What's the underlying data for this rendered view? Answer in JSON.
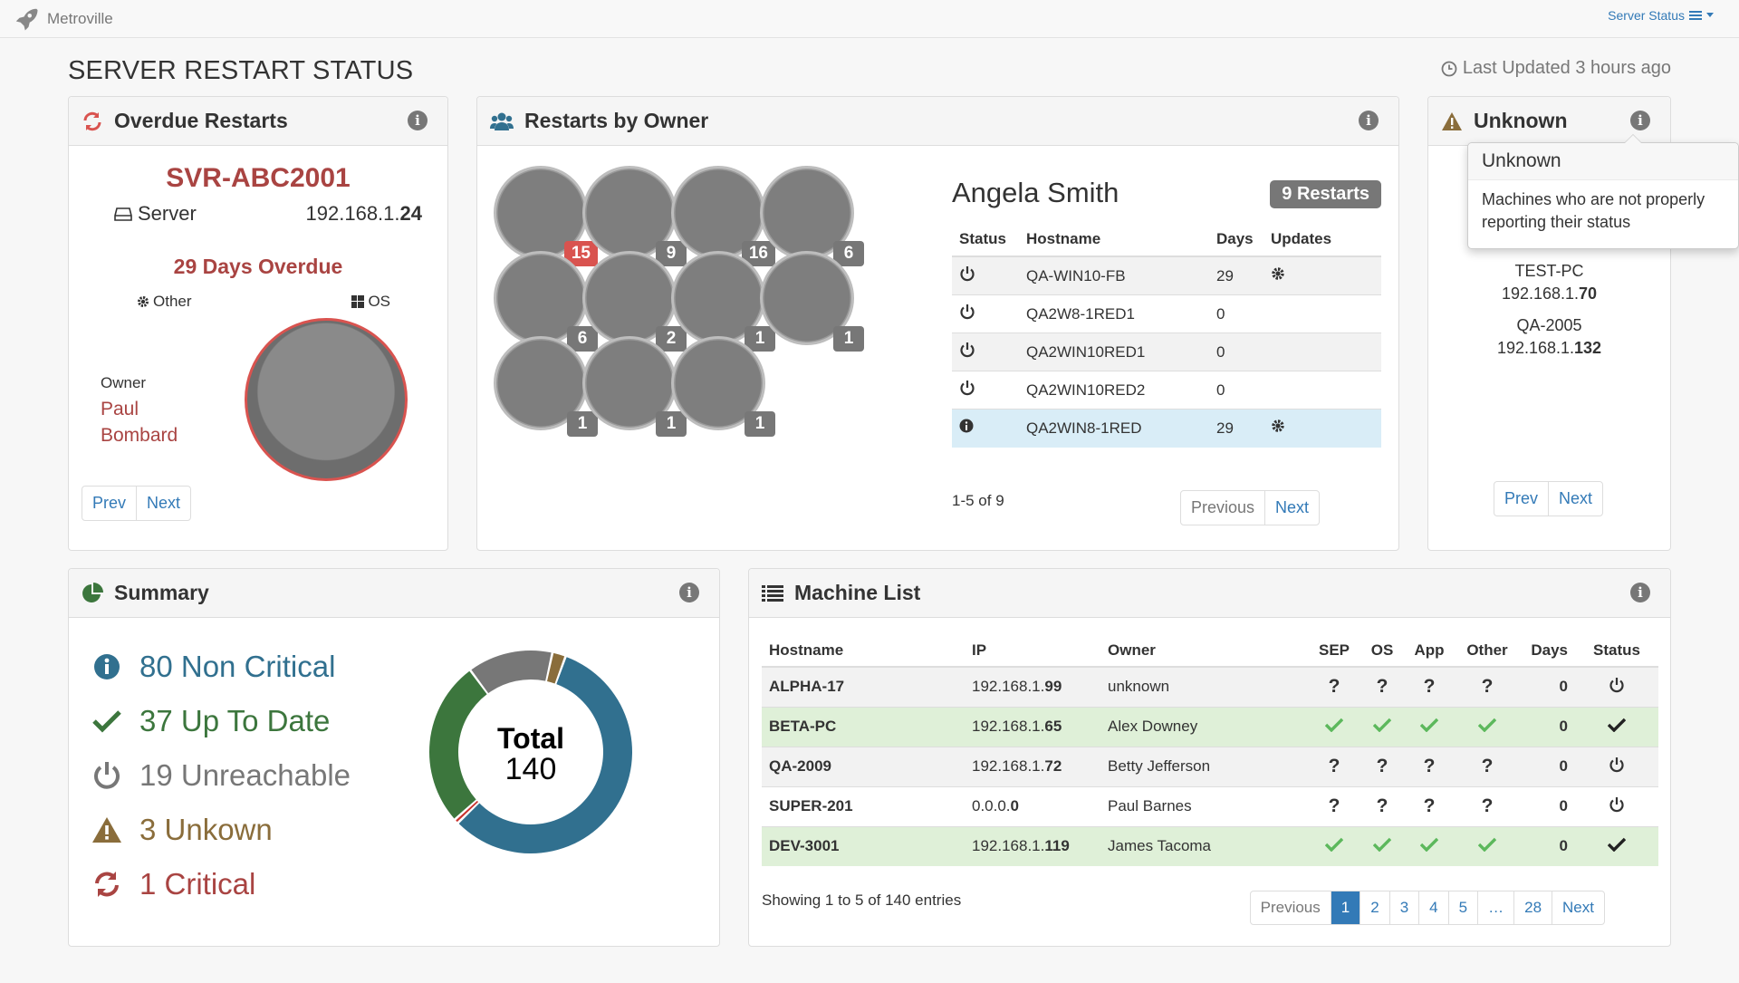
{
  "nav": {
    "brand": "Metroville",
    "menu": "Server Status"
  },
  "page": {
    "title": "SERVER RESTART STATUS",
    "last_updated": "Last Updated 3 hours ago"
  },
  "overdue": {
    "title": "Overdue Restarts",
    "hostname": "SVR-ABC2001",
    "type_label": "Server",
    "ip_prefix": "192.168.1.",
    "ip_last": "24",
    "days_overdue": "29 Days Overdue",
    "tag_other": "Other",
    "tag_os": "OS",
    "owner_label": "Owner",
    "owner_first": "Paul",
    "owner_last": "Bombard",
    "prev": "Prev",
    "next": "Next"
  },
  "owners": {
    "title": "Restarts by Owner",
    "avatars": [
      {
        "count": "15",
        "critical": true
      },
      {
        "count": "9",
        "critical": false
      },
      {
        "count": "16",
        "critical": false
      },
      {
        "count": "6",
        "critical": false
      },
      {
        "count": "6",
        "critical": false
      },
      {
        "count": "2",
        "critical": false
      },
      {
        "count": "1",
        "critical": false
      },
      {
        "count": "1",
        "critical": false
      },
      {
        "count": "1",
        "critical": false
      },
      {
        "count": "1",
        "critical": false
      },
      {
        "count": "1",
        "critical": false
      }
    ],
    "selected_owner": "Angela Smith",
    "restarts_badge": "9 Restarts",
    "columns": [
      "Status",
      "Hostname",
      "Days",
      "Updates"
    ],
    "rows": [
      {
        "status": "power",
        "hostname": "QA-WIN10-FB",
        "days": "29",
        "updates": "gear"
      },
      {
        "status": "power",
        "hostname": "QA2W8-1RED1",
        "days": "0",
        "updates": ""
      },
      {
        "status": "power",
        "hostname": "QA2WIN10RED1",
        "days": "0",
        "updates": ""
      },
      {
        "status": "power",
        "hostname": "QA2WIN10RED2",
        "days": "0",
        "updates": ""
      },
      {
        "status": "info",
        "hostname": "QA2WIN8-1RED",
        "days": "29",
        "updates": "gear"
      }
    ],
    "count": "1-5 of 9",
    "prev": "Previous",
    "next": "Next"
  },
  "unknown": {
    "title": "Unknown",
    "popover_title": "Unknown",
    "popover_body": "Machines who are not properly reporting their status",
    "items": [
      {
        "host": "TEST-PC",
        "ip_prefix": "192.168.1.",
        "ip_last": "70"
      },
      {
        "host": "QA-2005",
        "ip_prefix": "192.168.1.",
        "ip_last": "132"
      }
    ],
    "prev": "Prev",
    "next": "Next"
  },
  "summary": {
    "title": "Summary",
    "items": [
      {
        "label": "80 Non Critical",
        "color": "#31708f",
        "icon": "info-circle-icon"
      },
      {
        "label": "37 Up To Date",
        "color": "#3c763d",
        "icon": "check-icon"
      },
      {
        "label": "19 Unreachable",
        "color": "#777777",
        "icon": "power-icon"
      },
      {
        "label": "3 Unkown",
        "color": "#8a6d3b",
        "icon": "warning-icon"
      },
      {
        "label": "1 Critical",
        "color": "#a94442",
        "icon": "refresh-icon"
      }
    ],
    "donut_total_label": "Total",
    "donut_total": "140",
    "chart_data": {
      "type": "pie",
      "categories": [
        "Non Critical",
        "Critical",
        "Up To Date",
        "Unreachable",
        "Unkown"
      ],
      "values": [
        80,
        1,
        37,
        19,
        3
      ],
      "colors": [
        "#31708f",
        "#c9302c",
        "#3c763d",
        "#777777",
        "#8a6d3b"
      ]
    }
  },
  "machines": {
    "title": "Machine List",
    "columns": [
      "Hostname",
      "IP",
      "Owner",
      "SEP",
      "OS",
      "App",
      "Other",
      "Days",
      "Status"
    ],
    "rows": [
      {
        "hostname": "ALPHA-17",
        "ip_prefix": "192.168.1.",
        "ip_last": "99",
        "owner": "unknown",
        "sep": "?",
        "os": "?",
        "app": "?",
        "other": "?",
        "days": "0",
        "status": "power",
        "ok": false
      },
      {
        "hostname": "BETA-PC",
        "ip_prefix": "192.168.1.",
        "ip_last": "65",
        "owner": "Alex Downey",
        "sep": "check",
        "os": "check",
        "app": "check",
        "other": "check",
        "days": "0",
        "status": "check",
        "ok": true
      },
      {
        "hostname": "QA-2009",
        "ip_prefix": "192.168.1.",
        "ip_last": "72",
        "owner": "Betty Jefferson",
        "sep": "?",
        "os": "?",
        "app": "?",
        "other": "?",
        "days": "0",
        "status": "power",
        "ok": false
      },
      {
        "hostname": "SUPER-201",
        "ip_prefix": "0.0.0.",
        "ip_last": "0",
        "owner": "Paul Barnes",
        "sep": "?",
        "os": "?",
        "app": "?",
        "other": "?",
        "days": "0",
        "status": "power",
        "ok": false
      },
      {
        "hostname": "DEV-3001",
        "ip_prefix": "192.168.1.",
        "ip_last": "119",
        "owner": "James Tacoma",
        "sep": "check",
        "os": "check",
        "app": "check",
        "other": "check",
        "days": "0",
        "status": "check",
        "ok": true
      }
    ],
    "showing": "Showing 1 to 5 of 140 entries",
    "pages": [
      "Previous",
      "1",
      "2",
      "3",
      "4",
      "5",
      "…",
      "28",
      "Next"
    ],
    "active_page": "1"
  }
}
